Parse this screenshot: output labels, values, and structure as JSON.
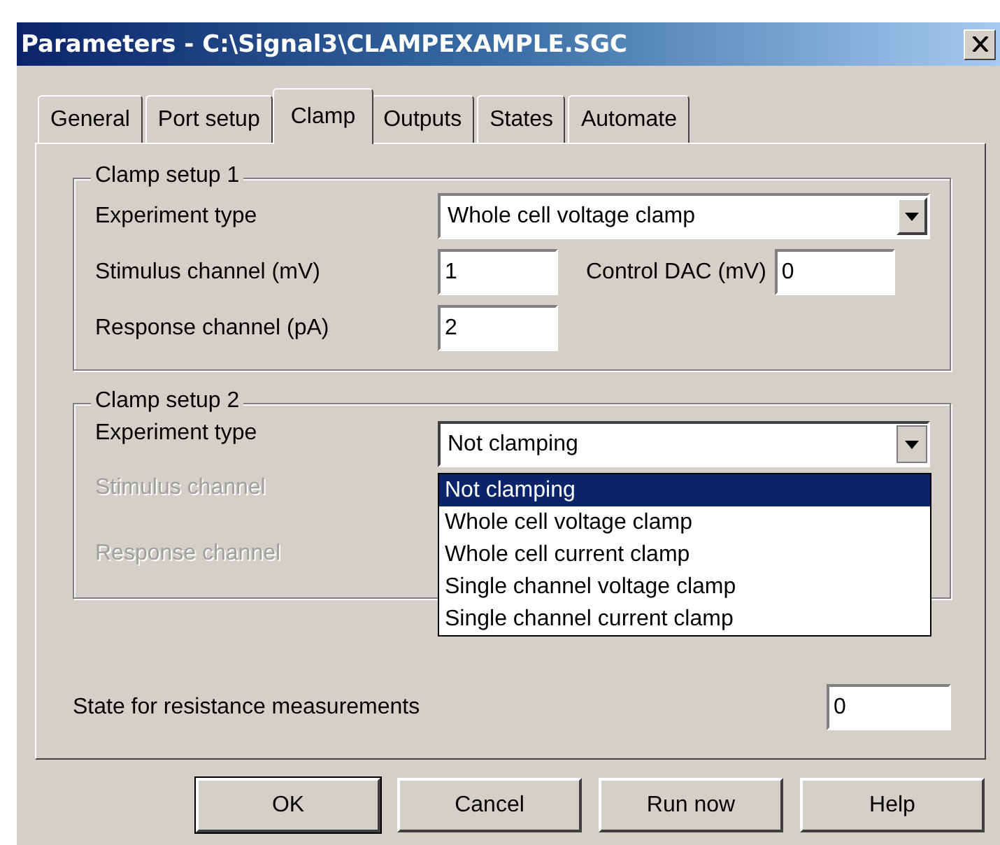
{
  "window": {
    "title": "Parameters - C:\\Signal3\\CLAMPEXAMPLE.SGC"
  },
  "tabs": [
    {
      "label": "General",
      "selected": false
    },
    {
      "label": "Port setup",
      "selected": false
    },
    {
      "label": "Clamp",
      "selected": true
    },
    {
      "label": "Outputs",
      "selected": false
    },
    {
      "label": "States",
      "selected": false
    },
    {
      "label": "Automate",
      "selected": false
    }
  ],
  "clamp_setup_1": {
    "title": "Clamp setup 1",
    "experiment_type": {
      "label": "Experiment type",
      "value": "Whole cell voltage clamp"
    },
    "stimulus_channel": {
      "label": "Stimulus channel (mV)",
      "value": "1"
    },
    "control_dac": {
      "label": "Control DAC (mV)",
      "value": "0"
    },
    "response_channel": {
      "label": "Response channel (pA)",
      "value": "2"
    }
  },
  "clamp_setup_2": {
    "title": "Clamp setup 2",
    "experiment_type": {
      "label": "Experiment type",
      "value": "Not clamping",
      "expanded": true,
      "options": [
        {
          "label": "Not clamping",
          "selected": true
        },
        {
          "label": "Whole cell voltage clamp",
          "selected": false
        },
        {
          "label": "Whole cell current clamp",
          "selected": false
        },
        {
          "label": "Single channel voltage clamp",
          "selected": false
        },
        {
          "label": "Single channel current clamp",
          "selected": false
        }
      ]
    },
    "stimulus_channel": {
      "label": "Stimulus channel",
      "disabled": true
    },
    "response_channel": {
      "label": "Response channel",
      "disabled": true
    }
  },
  "resistance_state": {
    "label": "State for resistance measurements",
    "value": "0"
  },
  "buttons": [
    {
      "label": "OK",
      "default": true
    },
    {
      "label": "Cancel",
      "default": false
    },
    {
      "label": "Run now",
      "default": false
    },
    {
      "label": "Help",
      "default": false
    }
  ]
}
